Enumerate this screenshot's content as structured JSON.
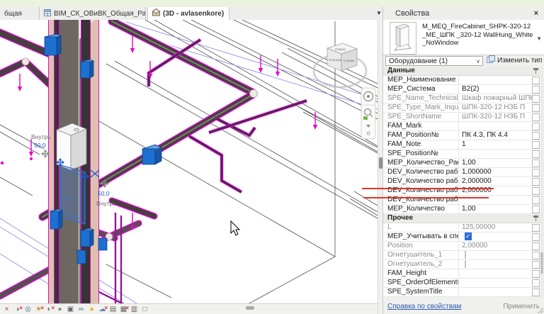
{
  "tab_bar": {
    "overflow_arrow": "▼",
    "tabs": [
      {
        "label": "бщая",
        "state": "partial"
      },
      {
        "label": "BIM_СК_ОВиВК_Общая_Разгруппи...",
        "icon": "schedule-icon",
        "state": "inactive"
      },
      {
        "label": "(3D - avlasenkore)",
        "icon": "3d-view-icon",
        "state": "active",
        "close_glyph": "×"
      }
    ]
  },
  "viewport": {
    "labels": {
      "offset_text_1": "Внутрь",
      "offset_dim_1": "50,0",
      "offset_dim_2": "50,0",
      "offset_text_2": "Внутрь"
    },
    "viewcube": {
      "top": "Сверху",
      "left": "Спереди",
      "right": "Справа"
    },
    "annotation_color": "#df352a"
  },
  "view_control_bar": {
    "icons": [
      {
        "name": "scale-icon",
        "glyph": "×",
        "color": "#b03a2e",
        "x": false
      },
      {
        "name": "detail-level-icon",
        "glyph": "◑",
        "color": "#666666",
        "x": true
      },
      {
        "name": "visual-style-icon",
        "glyph": "◎",
        "color": "#4a6a8a",
        "x": false
      },
      {
        "name": "sun-path-icon",
        "glyph": "☀",
        "color": "#b8860b",
        "x": true
      },
      {
        "name": "shadows-icon",
        "glyph": "◐",
        "color": "#666666",
        "x": true
      },
      {
        "name": "rendering-dialog-icon",
        "glyph": "●",
        "color": "#8a8a88",
        "x": false
      },
      {
        "name": "crop-view-icon",
        "glyph": "▣",
        "color": "#666666",
        "x": false
      },
      {
        "name": "temporary-hide-isolate-icon",
        "glyph": "∞",
        "color": "#1f7a8c",
        "x": false
      },
      {
        "name": "reveal-hidden-elements-icon",
        "glyph": "●",
        "color": "#e6b400",
        "x": false
      },
      {
        "name": "worksharing-display-icon",
        "glyph": "☁",
        "color": "#5b84b1",
        "x": true
      },
      {
        "name": "temporary-view-properties-icon",
        "glyph": "▤",
        "color": "#666666",
        "x": false
      },
      {
        "name": "analytical-model-icon",
        "glyph": "▦",
        "color": "#666666",
        "x": true
      },
      {
        "name": "constraints-icon",
        "glyph": "▥",
        "color": "#666666",
        "x": false
      },
      {
        "name": "displacement-sets-icon",
        "glyph": "□",
        "color": "#666666",
        "x": false
      }
    ]
  },
  "properties_panel": {
    "title": "Свойства",
    "close_glyph": "×",
    "type_name_lines": "M_MEQ_FireCabinet_SHPK-320-12_ME_ШПК _320-12 WallHung_White_NoWindow",
    "type_dropdown_glyph": "▼",
    "selector": {
      "value": "Оборудование (1)",
      "chevron": "∨"
    },
    "edit_type_label": "Изменить тип",
    "rows": [
      {
        "type": "section",
        "label": "Данные"
      },
      {
        "label": "MEP_Наименование п...",
        "value": ""
      },
      {
        "label": "MEP_Система",
        "value": "В2(2)"
      },
      {
        "label": "SPE_Name_Technical_ch...",
        "value": "Шкаф пожарный ШПК-...",
        "readonly": true
      },
      {
        "label": "SPE_Type_Mark_Inquiry...",
        "value": "ШПК-320-12 НЗБ П",
        "readonly": true
      },
      {
        "label": "SPE_ShortName",
        "value": "ШПК-320-12 НЗБ П",
        "readonly": true
      },
      {
        "label": "FAM_Mark",
        "value": ""
      },
      {
        "label": "FAM_Position№",
        "value": "ПК 4.3, ПК 4.4"
      },
      {
        "label": "FAM_Note",
        "value": "1"
      },
      {
        "label": "SPE_Position№",
        "value": ""
      },
      {
        "label": "MEP_Количество_Расче...",
        "value": "1,00"
      },
      {
        "label": "DEV_Количество работы",
        "value": "1,000000"
      },
      {
        "label": "DEV_Количество работ...",
        "value": "2,000000",
        "underlined": true
      },
      {
        "label": "DEV_Количество работ...",
        "value": "2,000000",
        "underlined": true
      },
      {
        "label": "DEV_Количество работ...",
        "value": ""
      },
      {
        "label": "MEP_Количество",
        "value": "1,00"
      },
      {
        "type": "section",
        "label": "Прочее"
      },
      {
        "label": "L",
        "value": "125,00000",
        "readonly": true
      },
      {
        "label": "MEP_Учитывать в спец...",
        "checkbox": true,
        "checked": true
      },
      {
        "label": "Position",
        "value": "2,00000",
        "readonly": true
      },
      {
        "label": "Огнетушитель_1",
        "checkbox": true,
        "checked": false,
        "readonly": true
      },
      {
        "label": "Огнетушитель_2",
        "checkbox": true,
        "checked": false,
        "readonly": true
      },
      {
        "label": "FAM_Height",
        "value": ""
      },
      {
        "label": "SPE_OrderOfElements",
        "value": ""
      },
      {
        "label": "SPE_SystemTitle",
        "value": ""
      }
    ],
    "footer": {
      "help_link": "Справка по свойствам",
      "apply_label": "Применить"
    }
  }
}
